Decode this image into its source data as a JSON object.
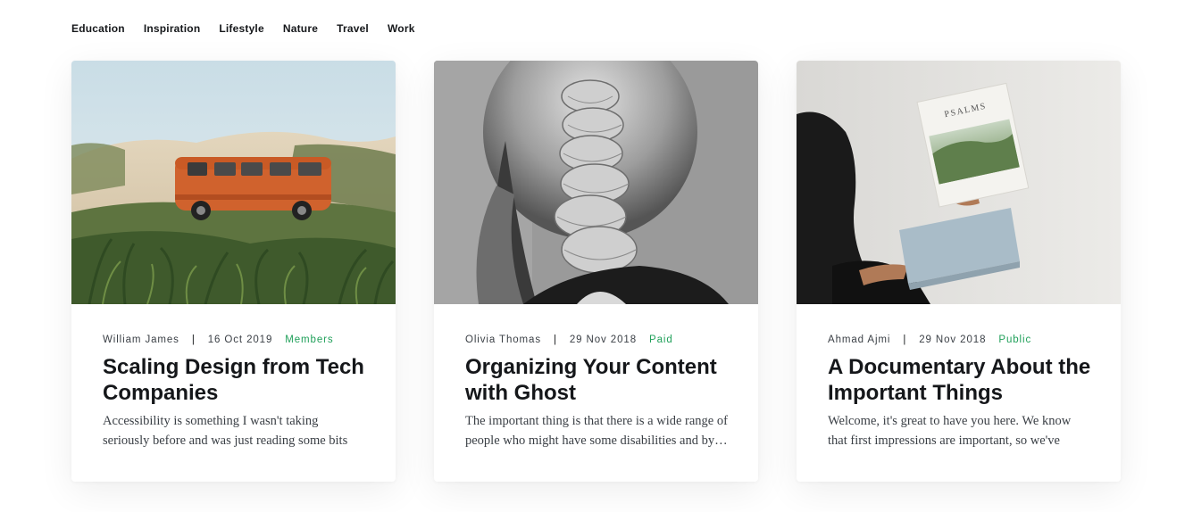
{
  "nav": {
    "items": [
      "Education",
      "Inspiration",
      "Lifestyle",
      "Nature",
      "Travel",
      "Work"
    ]
  },
  "posts": [
    {
      "author": "William James",
      "date": "16 Oct 2019",
      "tier": "Members",
      "title": "Scaling Design from Tech Companies",
      "excerpt": "Accessibility is something I wasn't taking seriously before and was just reading some bits here and the…",
      "image": "orange-van-on-sand-dunes"
    },
    {
      "author": "Olivia Thomas",
      "date": "29 Nov 2018",
      "tier": "Paid",
      "title": "Organizing Your Content with Ghost",
      "excerpt": "The important thing is that there is a wide range of people who might have some disabilities and by…",
      "image": "braided-hair-black-and-white"
    },
    {
      "author": "Ahmad Ajmi",
      "date": "29 Nov 2018",
      "tier": "Public",
      "title": "A Documentary About the Important Things",
      "excerpt": "Welcome, it's great to have you here. We know that first impressions are important, so we've populate…",
      "image": "hands-holding-books",
      "image_text": "PSALMS"
    }
  ],
  "colors": {
    "text": "#15171a",
    "meta": "#3a3f45",
    "tier_accent": "#20a05a",
    "van": "#d0622d"
  }
}
